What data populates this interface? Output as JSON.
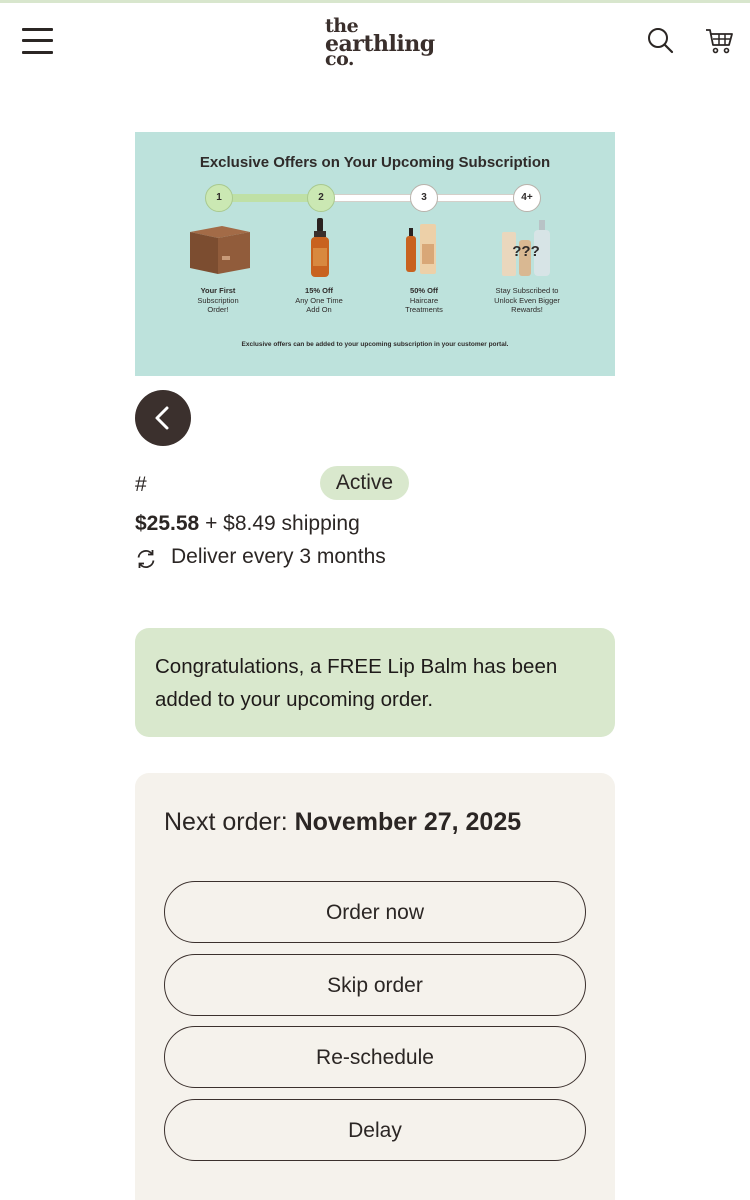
{
  "header": {
    "logo_line1": "the",
    "logo_line2": "earthling",
    "logo_line3": "co.",
    "icons": [
      "menu-icon",
      "search-icon",
      "cart-icon"
    ]
  },
  "promo": {
    "title": "Exclusive Offers on Your Upcoming Subscription",
    "steps": [
      "1",
      "2",
      "3",
      "4+"
    ],
    "tiers": [
      {
        "headline": "Your First",
        "line2": "Subscription",
        "line3": "Order!"
      },
      {
        "headline": "15% Off",
        "line2": "Any One Time",
        "line3": "Add On"
      },
      {
        "headline": "50% Off",
        "line2": "Haircare",
        "line3": "Treatments"
      },
      {
        "headline": "Stay Subscribed to",
        "line2": "Unlock Even Bigger",
        "line3": "Rewards!"
      }
    ],
    "mystery_text": "???",
    "footnote": "Exclusive offers can be added to your upcoming subscription in your customer portal.",
    "colors": {
      "background": "#bde2dc",
      "progress": "#bfe0a6"
    }
  },
  "subscription": {
    "hash": "#",
    "status": "Active",
    "price": "$25.58",
    "shipping": " + $8.49 shipping",
    "frequency": "Deliver every 3 months"
  },
  "notice": {
    "text": "Congratulations, a FREE Lip Balm has been added to your upcoming order."
  },
  "next_order": {
    "label": "Next order: ",
    "date": "November 27, 2025",
    "buttons": {
      "order_now": "Order now",
      "skip": "Skip order",
      "reschedule": "Re-schedule",
      "delay": "Delay"
    }
  },
  "colors": {
    "accent_green": "#d9e8cd",
    "card_beige": "#f5f2ec",
    "dark": "#3b302d"
  }
}
